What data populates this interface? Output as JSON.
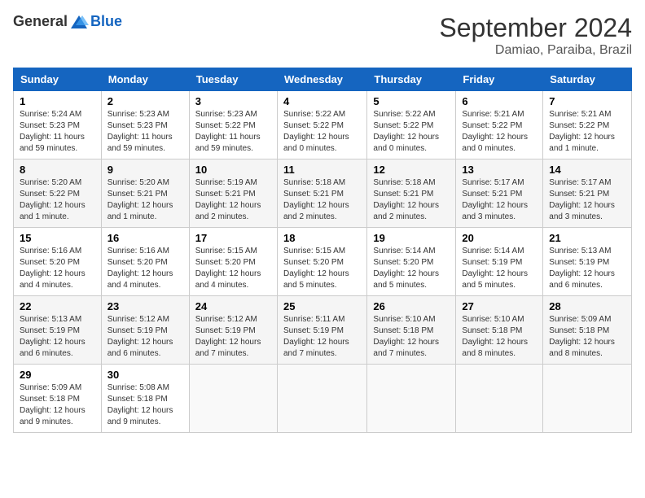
{
  "logo": {
    "general": "General",
    "blue": "Blue"
  },
  "title": "September 2024",
  "location": "Damiao, Paraiba, Brazil",
  "days_of_week": [
    "Sunday",
    "Monday",
    "Tuesday",
    "Wednesday",
    "Thursday",
    "Friday",
    "Saturday"
  ],
  "weeks": [
    [
      {
        "day": "1",
        "info": "Sunrise: 5:24 AM\nSunset: 5:23 PM\nDaylight: 11 hours\nand 59 minutes."
      },
      {
        "day": "2",
        "info": "Sunrise: 5:23 AM\nSunset: 5:23 PM\nDaylight: 11 hours\nand 59 minutes."
      },
      {
        "day": "3",
        "info": "Sunrise: 5:23 AM\nSunset: 5:22 PM\nDaylight: 11 hours\nand 59 minutes."
      },
      {
        "day": "4",
        "info": "Sunrise: 5:22 AM\nSunset: 5:22 PM\nDaylight: 12 hours\nand 0 minutes."
      },
      {
        "day": "5",
        "info": "Sunrise: 5:22 AM\nSunset: 5:22 PM\nDaylight: 12 hours\nand 0 minutes."
      },
      {
        "day": "6",
        "info": "Sunrise: 5:21 AM\nSunset: 5:22 PM\nDaylight: 12 hours\nand 0 minutes."
      },
      {
        "day": "7",
        "info": "Sunrise: 5:21 AM\nSunset: 5:22 PM\nDaylight: 12 hours\nand 1 minute."
      }
    ],
    [
      {
        "day": "8",
        "info": "Sunrise: 5:20 AM\nSunset: 5:22 PM\nDaylight: 12 hours\nand 1 minute."
      },
      {
        "day": "9",
        "info": "Sunrise: 5:20 AM\nSunset: 5:21 PM\nDaylight: 12 hours\nand 1 minute."
      },
      {
        "day": "10",
        "info": "Sunrise: 5:19 AM\nSunset: 5:21 PM\nDaylight: 12 hours\nand 2 minutes."
      },
      {
        "day": "11",
        "info": "Sunrise: 5:18 AM\nSunset: 5:21 PM\nDaylight: 12 hours\nand 2 minutes."
      },
      {
        "day": "12",
        "info": "Sunrise: 5:18 AM\nSunset: 5:21 PM\nDaylight: 12 hours\nand 2 minutes."
      },
      {
        "day": "13",
        "info": "Sunrise: 5:17 AM\nSunset: 5:21 PM\nDaylight: 12 hours\nand 3 minutes."
      },
      {
        "day": "14",
        "info": "Sunrise: 5:17 AM\nSunset: 5:21 PM\nDaylight: 12 hours\nand 3 minutes."
      }
    ],
    [
      {
        "day": "15",
        "info": "Sunrise: 5:16 AM\nSunset: 5:20 PM\nDaylight: 12 hours\nand 4 minutes."
      },
      {
        "day": "16",
        "info": "Sunrise: 5:16 AM\nSunset: 5:20 PM\nDaylight: 12 hours\nand 4 minutes."
      },
      {
        "day": "17",
        "info": "Sunrise: 5:15 AM\nSunset: 5:20 PM\nDaylight: 12 hours\nand 4 minutes."
      },
      {
        "day": "18",
        "info": "Sunrise: 5:15 AM\nSunset: 5:20 PM\nDaylight: 12 hours\nand 5 minutes."
      },
      {
        "day": "19",
        "info": "Sunrise: 5:14 AM\nSunset: 5:20 PM\nDaylight: 12 hours\nand 5 minutes."
      },
      {
        "day": "20",
        "info": "Sunrise: 5:14 AM\nSunset: 5:19 PM\nDaylight: 12 hours\nand 5 minutes."
      },
      {
        "day": "21",
        "info": "Sunrise: 5:13 AM\nSunset: 5:19 PM\nDaylight: 12 hours\nand 6 minutes."
      }
    ],
    [
      {
        "day": "22",
        "info": "Sunrise: 5:13 AM\nSunset: 5:19 PM\nDaylight: 12 hours\nand 6 minutes."
      },
      {
        "day": "23",
        "info": "Sunrise: 5:12 AM\nSunset: 5:19 PM\nDaylight: 12 hours\nand 6 minutes."
      },
      {
        "day": "24",
        "info": "Sunrise: 5:12 AM\nSunset: 5:19 PM\nDaylight: 12 hours\nand 7 minutes."
      },
      {
        "day": "25",
        "info": "Sunrise: 5:11 AM\nSunset: 5:19 PM\nDaylight: 12 hours\nand 7 minutes."
      },
      {
        "day": "26",
        "info": "Sunrise: 5:10 AM\nSunset: 5:18 PM\nDaylight: 12 hours\nand 7 minutes."
      },
      {
        "day": "27",
        "info": "Sunrise: 5:10 AM\nSunset: 5:18 PM\nDaylight: 12 hours\nand 8 minutes."
      },
      {
        "day": "28",
        "info": "Sunrise: 5:09 AM\nSunset: 5:18 PM\nDaylight: 12 hours\nand 8 minutes."
      }
    ],
    [
      {
        "day": "29",
        "info": "Sunrise: 5:09 AM\nSunset: 5:18 PM\nDaylight: 12 hours\nand 9 minutes."
      },
      {
        "day": "30",
        "info": "Sunrise: 5:08 AM\nSunset: 5:18 PM\nDaylight: 12 hours\nand 9 minutes."
      },
      {
        "day": "",
        "info": ""
      },
      {
        "day": "",
        "info": ""
      },
      {
        "day": "",
        "info": ""
      },
      {
        "day": "",
        "info": ""
      },
      {
        "day": "",
        "info": ""
      }
    ]
  ]
}
